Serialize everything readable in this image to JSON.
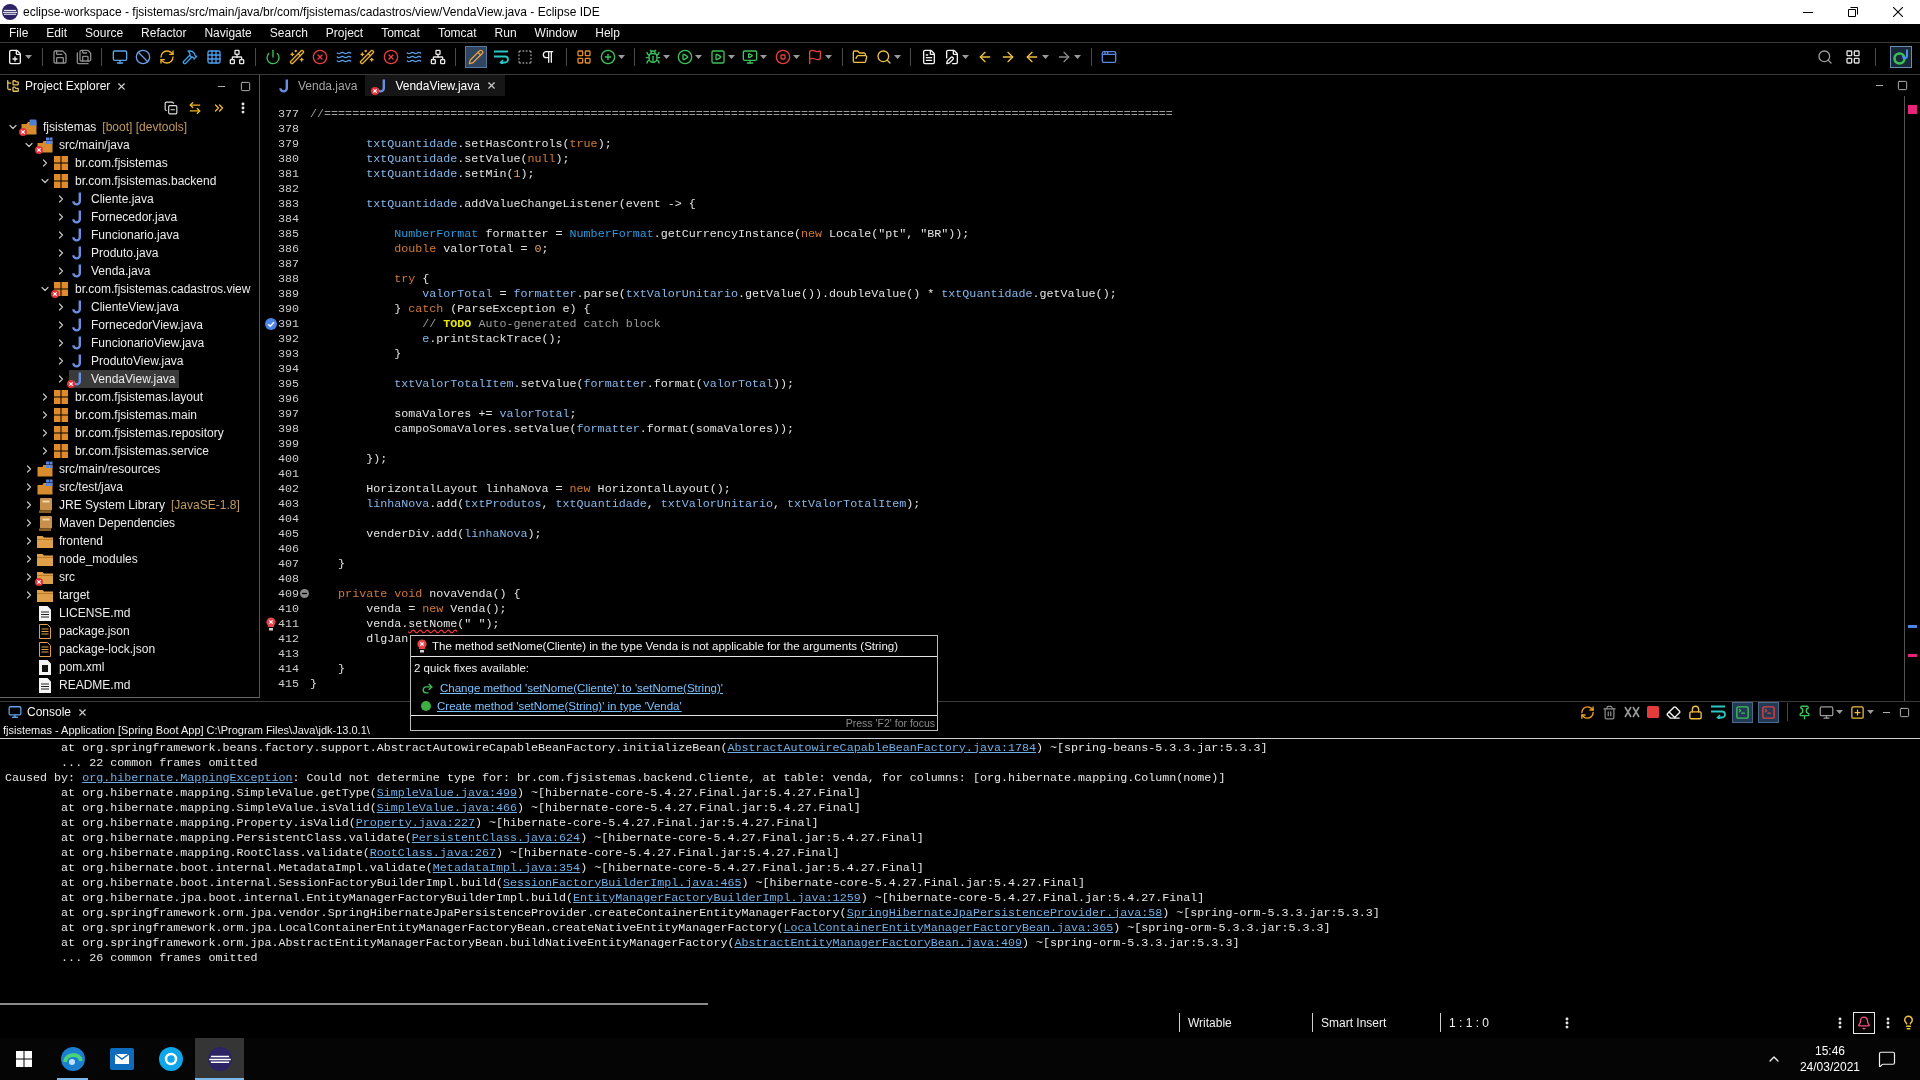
{
  "window": {
    "title": "eclipse-workspace - fjsistemas/src/main/java/br/com/fjsistemas/cadastros/view/VendaView.java - Eclipse IDE"
  },
  "menu": [
    "File",
    "Edit",
    "Source",
    "Refactor",
    "Navigate",
    "Search",
    "Project",
    "Tomcat",
    "Tomcat",
    "Run",
    "Window",
    "Help"
  ],
  "toolbar": {
    "pen_toggle": {
      "on": true
    },
    "perspective": {
      "selected": true
    }
  },
  "explorer": {
    "title": "Project Explorer",
    "tree": [
      {
        "label": "fjsistemas",
        "decoration": "[boot] [devtools]",
        "kind": "project",
        "error": true,
        "expanded": true,
        "selected": false,
        "children": [
          {
            "label": "src/main/java",
            "kind": "source-folder",
            "error": true,
            "expanded": true,
            "selected": false,
            "children": [
              {
                "label": "br.com.fjsistemas",
                "kind": "package",
                "error": false,
                "expanded": false,
                "selected": false
              },
              {
                "label": "br.com.fjsistemas.backend",
                "kind": "package",
                "error": false,
                "expanded": true,
                "selected": false,
                "children": [
                  {
                    "label": "Cliente.java",
                    "kind": "java",
                    "error": false,
                    "expanded": false,
                    "selected": false
                  },
                  {
                    "label": "Fornecedor.java",
                    "kind": "java",
                    "error": false,
                    "expanded": false,
                    "selected": false
                  },
                  {
                    "label": "Funcionario.java",
                    "kind": "java",
                    "error": false,
                    "expanded": false,
                    "selected": false
                  },
                  {
                    "label": "Produto.java",
                    "kind": "java",
                    "error": false,
                    "expanded": false,
                    "selected": false
                  },
                  {
                    "label": "Venda.java",
                    "kind": "java",
                    "error": false,
                    "expanded": false,
                    "selected": false
                  }
                ]
              },
              {
                "label": "br.com.fjsistemas.cadastros.view",
                "kind": "package",
                "error": true,
                "expanded": true,
                "selected": false,
                "children": [
                  {
                    "label": "ClienteView.java",
                    "kind": "java",
                    "error": false,
                    "expanded": false,
                    "selected": false
                  },
                  {
                    "label": "FornecedorView.java",
                    "kind": "java",
                    "error": false,
                    "expanded": false,
                    "selected": false
                  },
                  {
                    "label": "FuncionarioView.java",
                    "kind": "java",
                    "error": false,
                    "expanded": false,
                    "selected": false
                  },
                  {
                    "label": "ProdutoView.java",
                    "kind": "java",
                    "error": false,
                    "expanded": false,
                    "selected": false
                  },
                  {
                    "label": "VendaView.java",
                    "kind": "java",
                    "error": true,
                    "expanded": false,
                    "selected": true
                  }
                ]
              },
              {
                "label": "br.com.fjsistemas.layout",
                "kind": "package",
                "error": false,
                "expanded": false,
                "selected": false
              },
              {
                "label": "br.com.fjsistemas.main",
                "kind": "package",
                "error": false,
                "expanded": false,
                "selected": false
              },
              {
                "label": "br.com.fjsistemas.repository",
                "kind": "package",
                "error": false,
                "expanded": false,
                "selected": false
              },
              {
                "label": "br.com.fjsistemas.service",
                "kind": "package",
                "error": false,
                "expanded": false,
                "selected": false
              }
            ]
          },
          {
            "label": "src/main/resources",
            "kind": "source-folder",
            "error": false,
            "expanded": false,
            "selected": false
          },
          {
            "label": "src/test/java",
            "kind": "source-folder",
            "error": false,
            "expanded": false,
            "selected": false
          },
          {
            "label": "JRE System Library",
            "decoration": "[JavaSE-1.8]",
            "kind": "library",
            "error": false,
            "expanded": false,
            "selected": false
          },
          {
            "label": "Maven Dependencies",
            "kind": "library",
            "error": false,
            "expanded": false,
            "selected": false
          },
          {
            "label": "frontend",
            "kind": "folder",
            "error": false,
            "expanded": false,
            "selected": false
          },
          {
            "label": "node_modules",
            "kind": "folder",
            "error": false,
            "expanded": false,
            "selected": false
          },
          {
            "label": "src",
            "kind": "folder",
            "error": true,
            "expanded": false,
            "selected": false
          },
          {
            "label": "target",
            "kind": "folder",
            "error": false,
            "expanded": false,
            "selected": false
          },
          {
            "label": "LICENSE.md",
            "kind": "text-file",
            "error": false,
            "selected": false
          },
          {
            "label": "package.json",
            "kind": "json-file",
            "error": false,
            "selected": false
          },
          {
            "label": "package-lock.json",
            "kind": "json-file",
            "error": false,
            "selected": false
          },
          {
            "label": "pom.xml",
            "kind": "xml-file",
            "error": false,
            "selected": false
          },
          {
            "label": "README.md",
            "kind": "text-file",
            "error": false,
            "selected": false
          }
        ]
      }
    ]
  },
  "editor": {
    "tabs": [
      {
        "label": "Venda.java",
        "selected": false,
        "error": false
      },
      {
        "label": "VendaView.java",
        "selected": true,
        "error": true
      }
    ],
    "lines": [
      {
        "number": "377",
        "tokens": [
          {
            "kind": "comment",
            "text": "//========================================================================================================================="
          }
        ]
      },
      {
        "number": "378"
      },
      {
        "number": "379",
        "tokens": [
          {
            "kind": "field",
            "text": "        txtQuantidade"
          },
          {
            "kind": "plain",
            "text": ".setHasControls("
          },
          {
            "kind": "keyword",
            "text": "true"
          },
          {
            "kind": "plain",
            "text": ");"
          }
        ]
      },
      {
        "number": "380",
        "tokens": [
          {
            "kind": "field",
            "text": "        txtQuantidade"
          },
          {
            "kind": "plain",
            "text": ".setValue("
          },
          {
            "kind": "keyword",
            "text": "null"
          },
          {
            "kind": "plain",
            "text": ");"
          }
        ]
      },
      {
        "number": "381",
        "tokens": [
          {
            "kind": "field",
            "text": "        txtQuantidade"
          },
          {
            "kind": "plain",
            "text": ".setMin("
          },
          {
            "kind": "number",
            "text": "1"
          },
          {
            "kind": "plain",
            "text": ");"
          }
        ]
      },
      {
        "number": "382"
      },
      {
        "number": "383",
        "tokens": [
          {
            "kind": "field",
            "text": "        txtQuantidade"
          },
          {
            "kind": "plain",
            "text": ".addValueChangeListener(event -> {"
          }
        ]
      },
      {
        "number": "384"
      },
      {
        "number": "385",
        "tokens": [
          {
            "kind": "type",
            "text": "            NumberFormat"
          },
          {
            "kind": "plain",
            "text": " formatter = "
          },
          {
            "kind": "type",
            "text": "NumberFormat"
          },
          {
            "kind": "plain",
            "text": ".getCurrencyInstance("
          },
          {
            "kind": "keyword",
            "text": "new"
          },
          {
            "kind": "plain",
            "text": " Locale(\"pt\", \"BR\"));"
          }
        ]
      },
      {
        "number": "386",
        "tokens": [
          {
            "kind": "keyword",
            "text": "            double"
          },
          {
            "kind": "plain",
            "text": " valorTotal = "
          },
          {
            "kind": "number",
            "text": "0"
          },
          {
            "kind": "plain",
            "text": ";"
          }
        ]
      },
      {
        "number": "387"
      },
      {
        "number": "388",
        "tokens": [
          {
            "kind": "keyword",
            "text": "            try"
          },
          {
            "kind": "plain",
            "text": " {"
          }
        ]
      },
      {
        "number": "389",
        "tokens": [
          {
            "kind": "field",
            "text": "                valorTotal"
          },
          {
            "kind": "plain",
            "text": " = "
          },
          {
            "kind": "field",
            "text": "formatter"
          },
          {
            "kind": "plain",
            "text": ".parse("
          },
          {
            "kind": "field",
            "text": "txtValorUnitario"
          },
          {
            "kind": "plain",
            "text": ".getValue()).doubleValue() * "
          },
          {
            "kind": "field",
            "text": "txtQuantidade"
          },
          {
            "kind": "plain",
            "text": ".getValue();"
          }
        ]
      },
      {
        "number": "390",
        "tokens": [
          {
            "kind": "plain",
            "text": "            } "
          },
          {
            "kind": "keyword",
            "text": "catch"
          },
          {
            "kind": "plain",
            "text": " (ParseException e) {"
          }
        ]
      },
      {
        "number": "391",
        "marker": {
          "kind": "task"
        },
        "tokens": [
          {
            "kind": "comment",
            "text": "                // "
          },
          {
            "kind": "todo",
            "text": "TODO"
          },
          {
            "kind": "comment",
            "text": " Auto-generated catch block"
          }
        ]
      },
      {
        "number": "392",
        "tokens": [
          {
            "kind": "field",
            "text": "                e"
          },
          {
            "kind": "plain",
            "text": ".printStackTrace();"
          }
        ]
      },
      {
        "number": "393",
        "tokens": [
          {
            "kind": "plain",
            "text": "            }"
          }
        ]
      },
      {
        "number": "394"
      },
      {
        "number": "395",
        "tokens": [
          {
            "kind": "field",
            "text": "            txtValorTotalItem"
          },
          {
            "kind": "plain",
            "text": ".setValue("
          },
          {
            "kind": "field",
            "text": "formatter"
          },
          {
            "kind": "plain",
            "text": ".format("
          },
          {
            "kind": "field",
            "text": "valorTotal"
          },
          {
            "kind": "plain",
            "text": "));"
          }
        ]
      },
      {
        "number": "396"
      },
      {
        "number": "397",
        "tokens": [
          {
            "kind": "plain",
            "text": "            somaValores += "
          },
          {
            "kind": "field",
            "text": "valorTotal"
          },
          {
            "kind": "plain",
            "text": ";"
          }
        ]
      },
      {
        "number": "398",
        "tokens": [
          {
            "kind": "plain",
            "text": "            campoSomaValores.setValue("
          },
          {
            "kind": "field",
            "text": "formatter"
          },
          {
            "kind": "plain",
            "text": ".format(somaValores));"
          }
        ]
      },
      {
        "number": "399"
      },
      {
        "number": "400",
        "tokens": [
          {
            "kind": "plain",
            "text": "        });"
          }
        ]
      },
      {
        "number": "401"
      },
      {
        "number": "402",
        "tokens": [
          {
            "kind": "plain",
            "text": "        HorizontalLayout linhaNova = "
          },
          {
            "kind": "keyword",
            "text": "new"
          },
          {
            "kind": "plain",
            "text": " HorizontalLayout();"
          }
        ]
      },
      {
        "number": "403",
        "tokens": [
          {
            "kind": "field",
            "text": "        linhaNova"
          },
          {
            "kind": "plain",
            "text": ".add("
          },
          {
            "kind": "field",
            "text": "txtProdutos"
          },
          {
            "kind": "plain",
            "text": ", "
          },
          {
            "kind": "field",
            "text": "txtQuantidade"
          },
          {
            "kind": "plain",
            "text": ", "
          },
          {
            "kind": "field",
            "text": "txtValorUnitario"
          },
          {
            "kind": "plain",
            "text": ", "
          },
          {
            "kind": "field",
            "text": "txtValorTotalItem"
          },
          {
            "kind": "plain",
            "text": ");"
          }
        ]
      },
      {
        "number": "404"
      },
      {
        "number": "405",
        "tokens": [
          {
            "kind": "plain",
            "text": "        venderDiv.add("
          },
          {
            "kind": "field",
            "text": "linhaNova"
          },
          {
            "kind": "plain",
            "text": ");"
          }
        ]
      },
      {
        "number": "406"
      },
      {
        "number": "407",
        "tokens": [
          {
            "kind": "plain",
            "text": "    }"
          }
        ]
      },
      {
        "number": "408"
      },
      {
        "number": "409",
        "marker": {
          "kind": "fold"
        },
        "tokens": [
          {
            "kind": "keyword",
            "text": "    private void"
          },
          {
            "kind": "plain",
            "text": " novaVenda() {"
          }
        ]
      },
      {
        "number": "410",
        "tokens": [
          {
            "kind": "plain",
            "text": "        venda = "
          },
          {
            "kind": "keyword",
            "text": "new"
          },
          {
            "kind": "plain",
            "text": " Venda();"
          }
        ]
      },
      {
        "number": "411",
        "marker": {
          "kind": "error"
        },
        "tokens": [
          {
            "kind": "plain",
            "text": "        venda."
          },
          {
            "kind": "error",
            "text": "setNome"
          },
          {
            "kind": "plain",
            "text": "(\" \");"
          }
        ]
      },
      {
        "number": "412",
        "tokens": [
          {
            "kind": "plain",
            "text": "        dlgJan"
          }
        ]
      },
      {
        "number": "413"
      },
      {
        "number": "414",
        "tokens": [
          {
            "kind": "plain",
            "text": "    }"
          }
        ]
      },
      {
        "number": "415",
        "tokens": [
          {
            "kind": "plain",
            "text": "}"
          }
        ]
      }
    ],
    "hover": {
      "message": "The method setNome(Cliente) in the type Venda is not applicable for the arguments (String)",
      "fixes_heading": "2 quick fixes available:",
      "fixes": [
        {
          "kind": "change",
          "label": "Change method 'setNome(Cliente)' to 'setNome(String)'"
        },
        {
          "kind": "create",
          "label": "Create method 'setNome(String)' in type 'Venda'"
        }
      ],
      "hint": "Press 'F2' for focus"
    }
  },
  "console": {
    "title": "Console",
    "output_toggle": {
      "on": true
    },
    "error_toggle": {
      "on": true
    },
    "launch": "fjsistemas - Application [Spring Boot App] C:\\Program Files\\Java\\jdk-13.0.1\\",
    "lines": [
      {
        "tokens": [
          {
            "kind": "text",
            "text": "        at org.springframework.beans.factory.support.AbstractAutowireCapableBeanFactory.initializeBean("
          },
          {
            "kind": "link",
            "text": "AbstractAutowireCapableBeanFactory.java:1784"
          },
          {
            "kind": "text",
            "text": ") ~[spring-beans-5.3.3.jar:5.3.3]"
          }
        ]
      },
      {
        "tokens": [
          {
            "kind": "text",
            "text": "        ... 22 common frames omitted"
          }
        ]
      },
      {
        "tokens": [
          {
            "kind": "text",
            "text": "Caused by: "
          },
          {
            "kind": "link",
            "text": "org.hibernate.MappingException"
          },
          {
            "kind": "text",
            "text": ": Could not determine type for: br.com.fjsistemas.backend.Cliente, at table: venda, for columns: [org.hibernate.mapping.Column(nome)]"
          }
        ]
      },
      {
        "tokens": [
          {
            "kind": "text",
            "text": "        at org.hibernate.mapping.SimpleValue.getType("
          },
          {
            "kind": "link",
            "text": "SimpleValue.java:499"
          },
          {
            "kind": "text",
            "text": ") ~[hibernate-core-5.4.27.Final.jar:5.4.27.Final]"
          }
        ]
      },
      {
        "tokens": [
          {
            "kind": "text",
            "text": "        at org.hibernate.mapping.SimpleValue.isValid("
          },
          {
            "kind": "link",
            "text": "SimpleValue.java:466"
          },
          {
            "kind": "text",
            "text": ") ~[hibernate-core-5.4.27.Final.jar:5.4.27.Final]"
          }
        ]
      },
      {
        "tokens": [
          {
            "kind": "text",
            "text": "        at org.hibernate.mapping.Property.isValid("
          },
          {
            "kind": "link",
            "text": "Property.java:227"
          },
          {
            "kind": "text",
            "text": ") ~[hibernate-core-5.4.27.Final.jar:5.4.27.Final]"
          }
        ]
      },
      {
        "tokens": [
          {
            "kind": "text",
            "text": "        at org.hibernate.mapping.PersistentClass.validate("
          },
          {
            "kind": "link",
            "text": "PersistentClass.java:624"
          },
          {
            "kind": "text",
            "text": ") ~[hibernate-core-5.4.27.Final.jar:5.4.27.Final]"
          }
        ]
      },
      {
        "tokens": [
          {
            "kind": "text",
            "text": "        at org.hibernate.mapping.RootClass.validate("
          },
          {
            "kind": "link",
            "text": "RootClass.java:267"
          },
          {
            "kind": "text",
            "text": ") ~[hibernate-core-5.4.27.Final.jar:5.4.27.Final]"
          }
        ]
      },
      {
        "tokens": [
          {
            "kind": "text",
            "text": "        at org.hibernate.boot.internal.MetadataImpl.validate("
          },
          {
            "kind": "link",
            "text": "MetadataImpl.java:354"
          },
          {
            "kind": "text",
            "text": ") ~[hibernate-core-5.4.27.Final.jar:5.4.27.Final]"
          }
        ]
      },
      {
        "tokens": [
          {
            "kind": "text",
            "text": "        at org.hibernate.boot.internal.SessionFactoryBuilderImpl.build("
          },
          {
            "kind": "link",
            "text": "SessionFactoryBuilderImpl.java:465"
          },
          {
            "kind": "text",
            "text": ") ~[hibernate-core-5.4.27.Final.jar:5.4.27.Final]"
          }
        ]
      },
      {
        "tokens": [
          {
            "kind": "text",
            "text": "        at org.hibernate.jpa.boot.internal.EntityManagerFactoryBuilderImpl.build("
          },
          {
            "kind": "link",
            "text": "EntityManagerFactoryBuilderImpl.java:1259"
          },
          {
            "kind": "text",
            "text": ") ~[hibernate-core-5.4.27.Final.jar:5.4.27.Final]"
          }
        ]
      },
      {
        "tokens": [
          {
            "kind": "text",
            "text": "        at org.springframework.orm.jpa.vendor.SpringHibernateJpaPersistenceProvider.createContainerEntityManagerFactory("
          },
          {
            "kind": "link",
            "text": "SpringHibernateJpaPersistenceProvider.java:58"
          },
          {
            "kind": "text",
            "text": ") ~[spring-orm-5.3.3.jar:5.3.3]"
          }
        ]
      },
      {
        "tokens": [
          {
            "kind": "text",
            "text": "        at org.springframework.orm.jpa.LocalContainerEntityManagerFactoryBean.createNativeEntityManagerFactory("
          },
          {
            "kind": "link",
            "text": "LocalContainerEntityManagerFactoryBean.java:365"
          },
          {
            "kind": "text",
            "text": ") ~[spring-orm-5.3.3.jar:5.3.3]"
          }
        ]
      },
      {
        "tokens": [
          {
            "kind": "text",
            "text": "        at org.springframework.orm.jpa.AbstractEntityManagerFactoryBean.buildNativeEntityManagerFactory("
          },
          {
            "kind": "link",
            "text": "AbstractEntityManagerFactoryBean.java:409"
          },
          {
            "kind": "text",
            "text": ") ~[spring-orm-5.3.3.jar:5.3.3]"
          }
        ]
      },
      {
        "tokens": [
          {
            "kind": "text",
            "text": "        ... 26 common frames omitted"
          }
        ]
      }
    ]
  },
  "status_bar": {
    "fields": [
      "Writable",
      "Smart Insert",
      "1 : 1 : 0"
    ]
  },
  "taskbar": {
    "apps": [
      {
        "kind": "browser",
        "running": true,
        "selected": false
      },
      {
        "kind": "mail",
        "running": false,
        "selected": false
      },
      {
        "kind": "chat",
        "running": false,
        "selected": false
      },
      {
        "kind": "ide",
        "running": true,
        "selected": true
      }
    ],
    "time": "15:46",
    "date": "24/03/2021"
  }
}
